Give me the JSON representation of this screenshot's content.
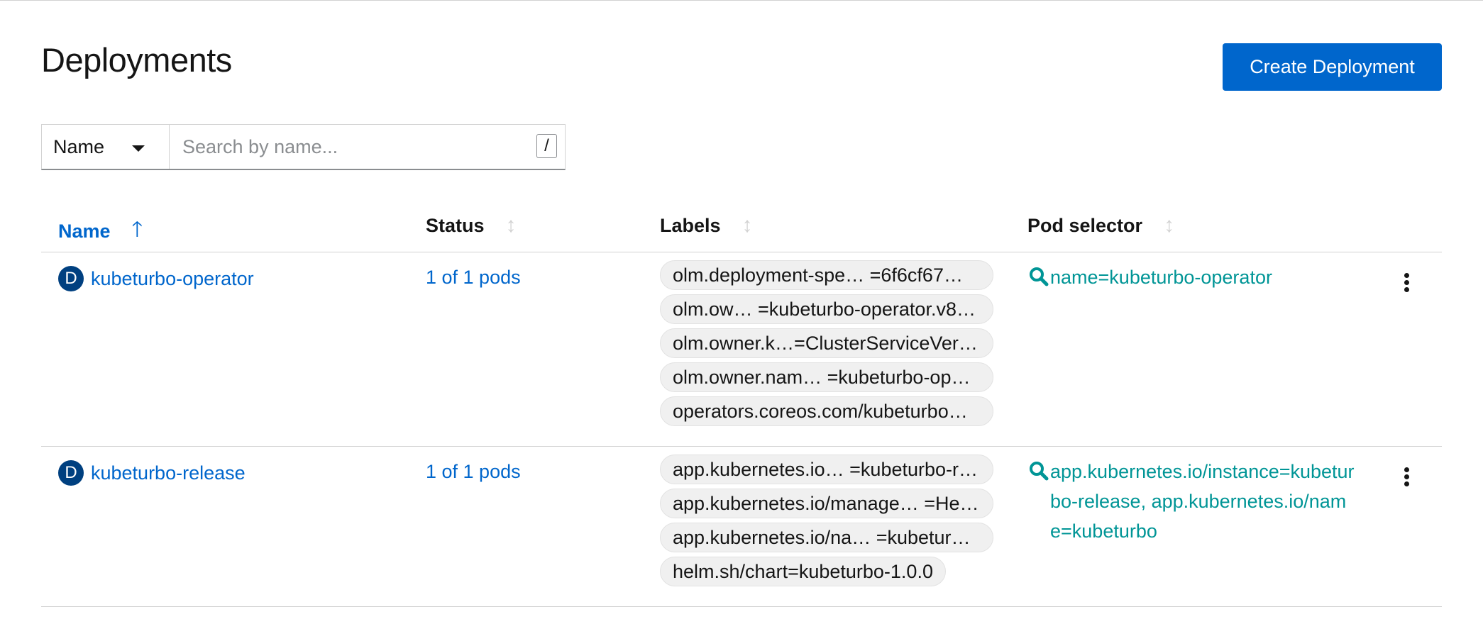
{
  "page": {
    "title": "Deployments",
    "create_button": "Create Deployment"
  },
  "filter": {
    "type": "Name",
    "placeholder": "Search by name...",
    "shortcut": "/"
  },
  "table": {
    "columns": [
      {
        "label": "Name",
        "sorted": "ascending"
      },
      {
        "label": "Status"
      },
      {
        "label": "Labels"
      },
      {
        "label": "Pod selector"
      }
    ],
    "rows": [
      {
        "badge": "D",
        "name": "kubeturbo-operator",
        "status": "1 of 1 pods",
        "labels": [
          "olm.deployment-spe… =6f6cf67…",
          "olm.ow… =kubeturbo-operator.v8…",
          "olm.owner.k…=ClusterServiceVer…",
          "olm.owner.nam… =kubeturbo-op…",
          "operators.coreos.com/kubeturbo…"
        ],
        "pod_selector": "name=kubeturbo-operator"
      },
      {
        "badge": "D",
        "name": "kubeturbo-release",
        "status": "1 of 1 pods",
        "labels": [
          "app.kubernetes.io… =kubeturbo-r…",
          "app.kubernetes.io/manage… =He…",
          "app.kubernetes.io/na… =kubetur…",
          "helm.sh/chart=kubeturbo-1.0.0"
        ],
        "pod_selector": "app.kubernetes.io/instance=kubeturbo-release, app.kubernetes.io/name=kubeturbo"
      }
    ]
  },
  "colors": {
    "primary": "#0066cc",
    "badge": "#004080",
    "selector": "#009596"
  },
  "icons": {
    "sort_active": "arrow-up-icon",
    "sort_inactive": "sort-icon",
    "selector": "search-icon",
    "row_actions": "kebab-icon"
  }
}
